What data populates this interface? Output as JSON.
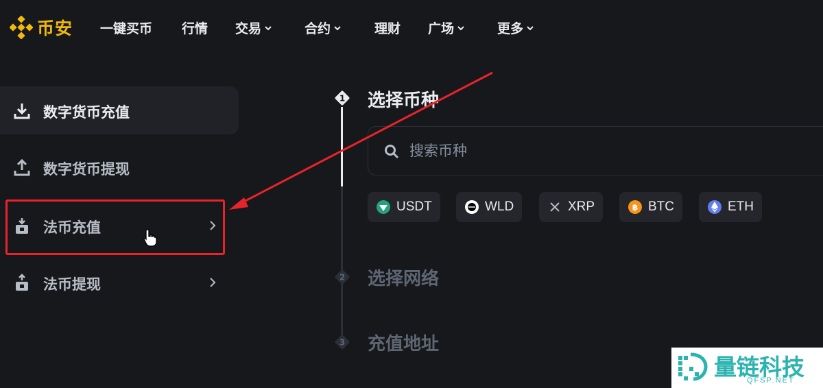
{
  "brand": {
    "name": "币安",
    "color": "#f0b90b"
  },
  "nav": {
    "items": [
      {
        "label": "一键买币",
        "has_dropdown": false
      },
      {
        "label": "行情",
        "has_dropdown": false
      },
      {
        "label": "交易",
        "has_dropdown": true
      },
      {
        "label": "合约",
        "has_dropdown": true
      },
      {
        "label": "理财",
        "has_dropdown": false
      },
      {
        "label": "广场",
        "has_dropdown": true
      },
      {
        "label": "更多",
        "has_dropdown": true
      }
    ]
  },
  "sidebar": {
    "items": [
      {
        "label": "数字货币充值",
        "icon": "download-icon",
        "active": true
      },
      {
        "label": "数字货币提现",
        "icon": "upload-icon",
        "active": false
      },
      {
        "label": "法币充值",
        "icon": "fiat-deposit-icon",
        "active": false,
        "has_chevron": true,
        "highlighted": true
      },
      {
        "label": "法币提现",
        "icon": "fiat-withdraw-icon",
        "active": false,
        "has_chevron": true
      }
    ]
  },
  "steps": [
    {
      "number": "1",
      "title": "选择币种",
      "active": true
    },
    {
      "number": "2",
      "title": "选择网络",
      "active": false
    },
    {
      "number": "3",
      "title": "充值地址",
      "active": false
    }
  ],
  "search": {
    "placeholder": "搜索币种",
    "value": ""
  },
  "coins": [
    {
      "symbol": "USDT",
      "icon": "usdt-icon",
      "color": "#26a17b"
    },
    {
      "symbol": "WLD",
      "icon": "wld-icon",
      "color": "#ffffff"
    },
    {
      "symbol": "XRP",
      "icon": "xrp-icon",
      "color": "#b7bdc6"
    },
    {
      "symbol": "BTC",
      "icon": "btc-icon",
      "color": "#f7931a"
    },
    {
      "symbol": "ETH",
      "icon": "eth-icon",
      "color": "#627eea"
    }
  ],
  "annotation": {
    "color": "#e8242a"
  },
  "watermark": {
    "title": "量链科技",
    "domain": "QFSP.NET",
    "color": "#2bb3b0"
  }
}
